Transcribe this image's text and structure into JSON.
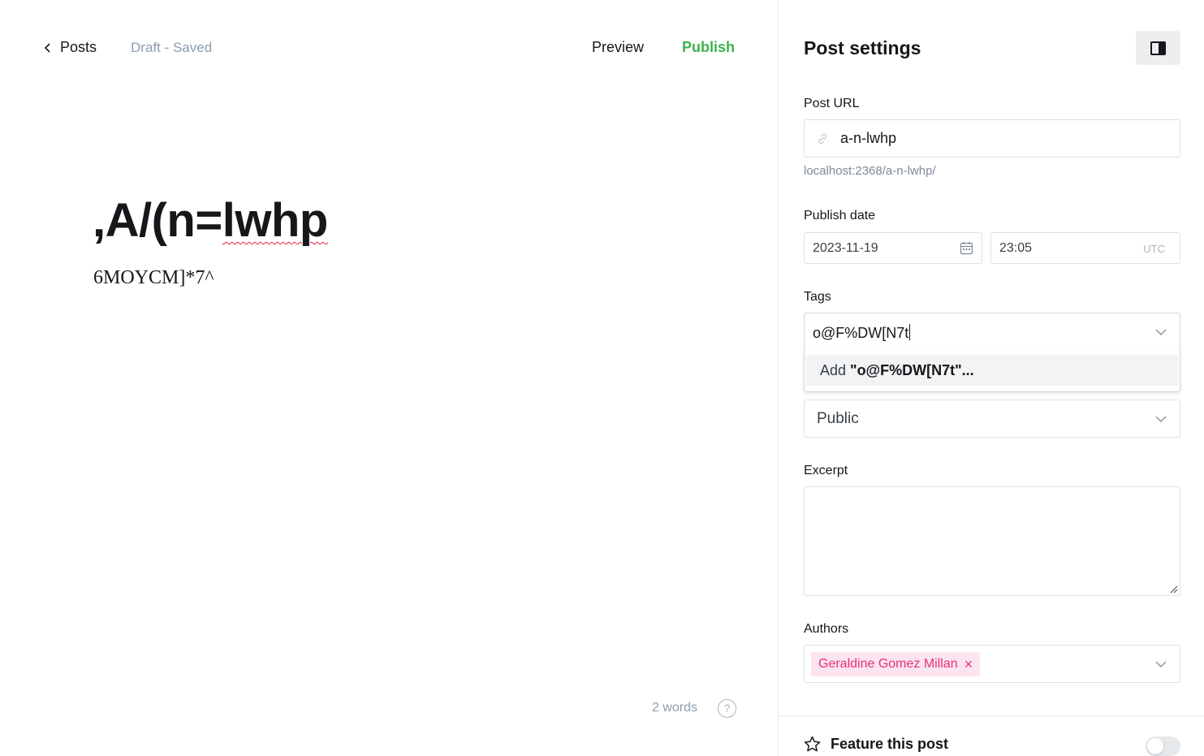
{
  "editor": {
    "back_label": "Posts",
    "status": "Draft - Saved",
    "preview_label": "Preview",
    "publish_label": "Publish",
    "title_prefix": ",A/(n=",
    "title_misspelled": "lwhp",
    "body_text": "6MOYCM]*7^",
    "word_count": "2 words",
    "help_symbol": "?"
  },
  "sidebar": {
    "title": "Post settings",
    "post_url": {
      "label": "Post URL",
      "value": "a-n-lwhp",
      "full_url": "localhost:2368/a-n-lwhp/"
    },
    "publish_date": {
      "label": "Publish date",
      "date": "2023-11-19",
      "time": "23:05",
      "timezone": "UTC"
    },
    "tags": {
      "label": "Tags",
      "input_value": "o@F%DW[N7t",
      "suggestion_prefix": "Add ",
      "suggestion_value": "\"o@F%DW[N7t\"..."
    },
    "visibility": {
      "value": "Public"
    },
    "excerpt": {
      "label": "Excerpt",
      "value": ""
    },
    "authors": {
      "label": "Authors",
      "items": [
        "Geraldine Gomez Millan"
      ],
      "remove_symbol": "×"
    },
    "feature": {
      "label": "Feature this post",
      "enabled": false
    }
  },
  "colors": {
    "publish_green": "#3eb24c",
    "author_pink": "#e5317a",
    "muted_text": "#8e9cac"
  }
}
